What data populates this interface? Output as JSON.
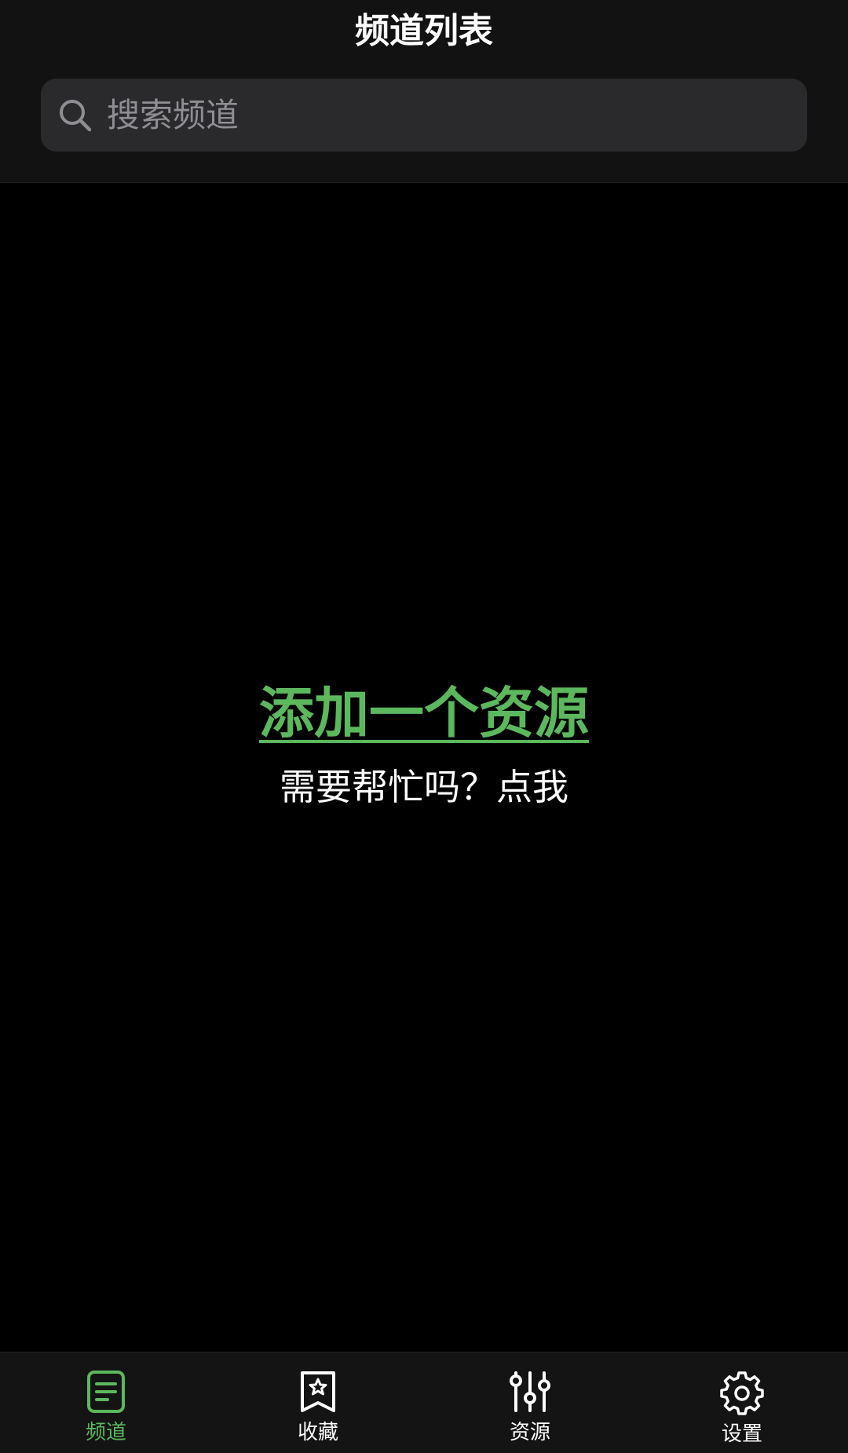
{
  "header": {
    "title": "频道列表"
  },
  "search": {
    "placeholder": "搜索频道",
    "value": "",
    "icon": "search-icon"
  },
  "empty_state": {
    "add_source_link": "添加一个资源",
    "help_text": "需要帮忙吗？点我"
  },
  "tabs": [
    {
      "label": "频道",
      "icon": "channel-list-icon",
      "active": true
    },
    {
      "label": "收藏",
      "icon": "bookmark-star-icon",
      "active": false
    },
    {
      "label": "资源",
      "icon": "sliders-icon",
      "active": false
    },
    {
      "label": "设置",
      "icon": "gear-icon",
      "active": false
    }
  ],
  "colors": {
    "accent": "#5cb85c",
    "header_bg": "#121212",
    "search_bg": "#2a2a2c",
    "body_bg": "#000000",
    "tabbar_bg": "#141414"
  }
}
